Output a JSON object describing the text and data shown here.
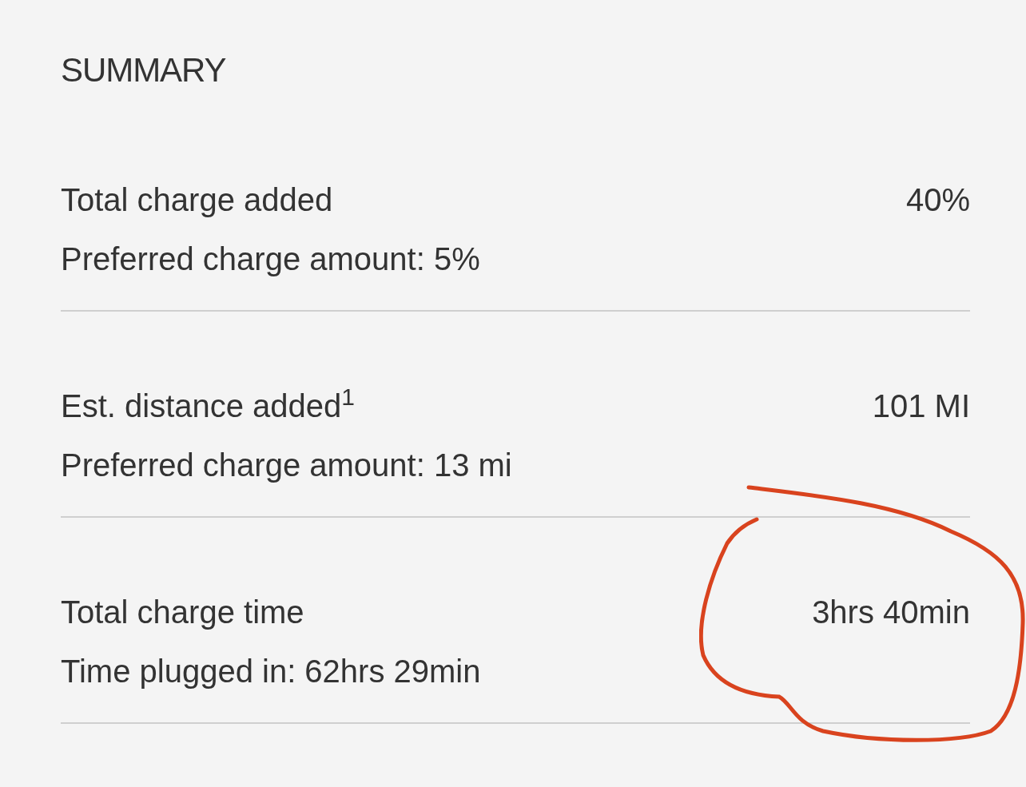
{
  "title": "SUMMARY",
  "rows": [
    {
      "label": "Total charge added",
      "value": "40%",
      "detail": "Preferred charge amount: 5%"
    },
    {
      "label": "Est. distance added$^{1}$",
      "value": "101 MI",
      "detail": "Preferred charge amount: 13 mi"
    },
    {
      "label": "Total charge time",
      "value": "3hrs 40min",
      "detail": "Time plugged in: 62hrs 29min"
    }
  ]
}
